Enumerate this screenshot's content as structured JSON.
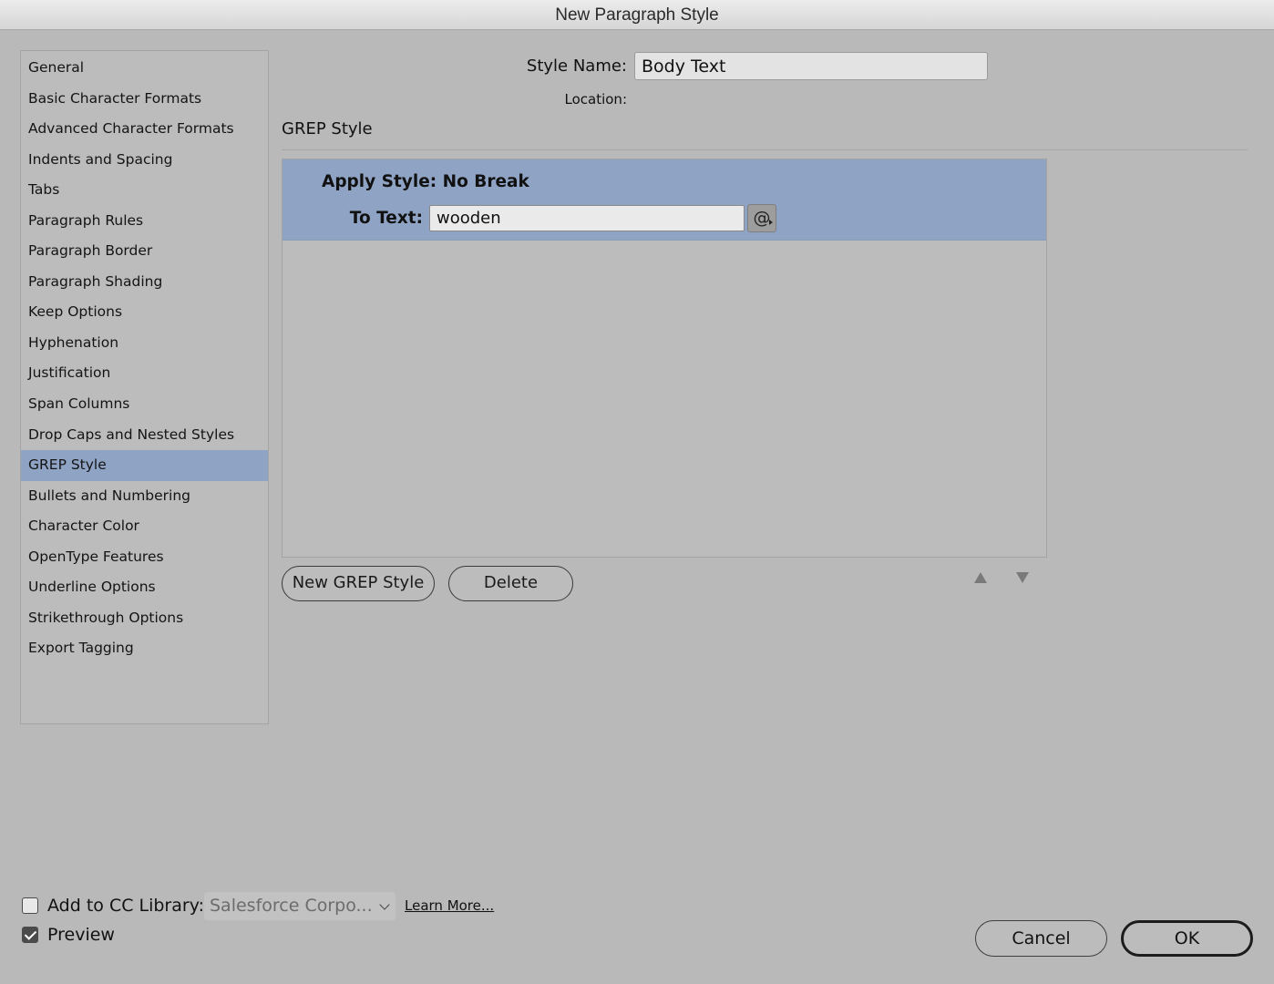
{
  "window": {
    "title": "New Paragraph Style"
  },
  "sidebar": {
    "items": [
      {
        "label": "General",
        "active": false
      },
      {
        "label": "Basic Character Formats",
        "active": false
      },
      {
        "label": "Advanced Character Formats",
        "active": false
      },
      {
        "label": "Indents and Spacing",
        "active": false
      },
      {
        "label": "Tabs",
        "active": false
      },
      {
        "label": "Paragraph Rules",
        "active": false
      },
      {
        "label": "Paragraph Border",
        "active": false
      },
      {
        "label": "Paragraph Shading",
        "active": false
      },
      {
        "label": "Keep Options",
        "active": false
      },
      {
        "label": "Hyphenation",
        "active": false
      },
      {
        "label": "Justification",
        "active": false
      },
      {
        "label": "Span Columns",
        "active": false
      },
      {
        "label": "Drop Caps and Nested Styles",
        "active": false
      },
      {
        "label": "GREP Style",
        "active": true
      },
      {
        "label": "Bullets and Numbering",
        "active": false
      },
      {
        "label": "Character Color",
        "active": false
      },
      {
        "label": "OpenType Features",
        "active": false
      },
      {
        "label": "Underline Options",
        "active": false
      },
      {
        "label": "Strikethrough Options",
        "active": false
      },
      {
        "label": "Export Tagging",
        "active": false
      }
    ]
  },
  "header": {
    "style_name_label": "Style Name:",
    "style_name_value": "Body Text",
    "location_label": "Location:"
  },
  "section": {
    "title": "GREP Style"
  },
  "grep": {
    "rule": {
      "apply_text": "Apply Style: No Break",
      "to_text_label": "To Text:",
      "to_text_value": "wooden",
      "special_char_glyph": "@"
    },
    "new_button": "New GREP Style",
    "delete_button": "Delete"
  },
  "footer": {
    "cc_label": "Add to CC Library:",
    "cc_checked": false,
    "library_value": "Salesforce Corpo...",
    "learn_more": "Learn More...",
    "preview_label": "Preview",
    "preview_checked": true,
    "cancel": "Cancel",
    "ok": "OK"
  },
  "colors": {
    "dialog_bg": "#b9b9b9",
    "selection": "#8fa4c5"
  }
}
